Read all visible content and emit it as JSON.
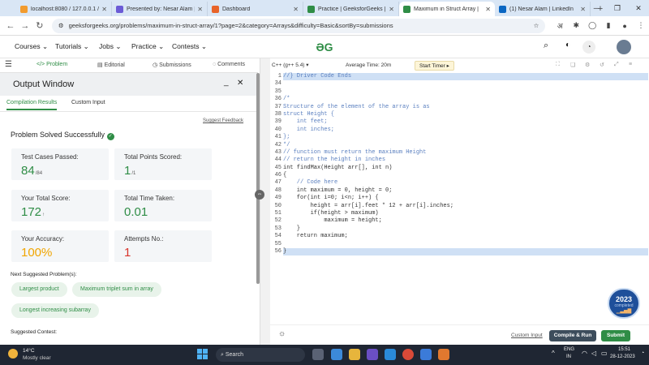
{
  "browser": {
    "tabs": [
      {
        "title": "localhost:8080 / 127.0.0.1 / ",
        "color": "#f29b2e",
        "active": false
      },
      {
        "title": "Presented by: Nesar Alam | ",
        "color": "#6b5bd6",
        "active": false
      },
      {
        "title": "Dashboard",
        "color": "#e8642a",
        "active": false
      },
      {
        "title": "Practice | GeeksforGeeks | ",
        "color": "#2f8d46",
        "active": false
      },
      {
        "title": "Maximum in Struct Array | ",
        "color": "#2f8d46",
        "active": true
      },
      {
        "title": "(1) Nesar Alam | LinkedIn",
        "color": "#0a66c2",
        "active": false
      }
    ],
    "url": "geeksforgeeks.org/problems/maximum-in-struct-array/1?page=2&category=Arrays&difficulty=Basic&sortBy=submissions",
    "lang_icon": "अ"
  },
  "site": {
    "menu": [
      "Courses",
      "Tutorials",
      "Jobs",
      "Practice",
      "Contests"
    ]
  },
  "problem_tabs": [
    "Problem",
    "Editorial",
    "Submissions",
    "Comments"
  ],
  "output": {
    "title": "Output Window",
    "tabs": [
      "Compilation Results",
      "Custom Input"
    ],
    "suggest_feedback": "Suggest Feedback",
    "status": "Problem Solved Successfully",
    "cards": [
      {
        "label": "Test Cases Passed:",
        "value": "84",
        "sub": "/84",
        "color": "#2f8d46"
      },
      {
        "label": "Total Points Scored:",
        "value": "1",
        "sub": "/1",
        "color": "#2f8d46"
      },
      {
        "label": "Your Total Score:",
        "value": "172",
        "sub": "↑",
        "color": "#2f8d46"
      },
      {
        "label": "Total Time Taken:",
        "value": "0.01",
        "sub": "",
        "color": "#2f8d46"
      },
      {
        "label": "Your Accuracy:",
        "value": "100%",
        "sub": "",
        "color": "#f0a500"
      },
      {
        "label": "Attempts No.:",
        "value": "1",
        "sub": "",
        "color": "#d9342b"
      }
    ],
    "next_label": "Next Suggested Problem(s):",
    "suggestions": [
      "Largest product",
      "Maximum triplet sum in array",
      "Longest increasing subarray"
    ],
    "contest_label": "Suggested Contest:"
  },
  "editor": {
    "language": "C++ (g++ 5.4)",
    "avg_time": "Average Time: 20m",
    "start_timer": "Start Timer",
    "lines": [
      {
        "n": "1",
        "t": "//} Driver Code Ends",
        "c": "cmt",
        "hl": true
      },
      {
        "n": "34",
        "t": "",
        "c": "",
        "hl": false
      },
      {
        "n": "35",
        "t": "",
        "c": "",
        "hl": false
      },
      {
        "n": "36",
        "t": "/*",
        "c": "cmt",
        "hl": false
      },
      {
        "n": "37",
        "t": "Structure of the element of the array is as",
        "c": "cmt",
        "hl": false
      },
      {
        "n": "38",
        "t": "struct Height {",
        "c": "cmt",
        "hl": false
      },
      {
        "n": "39",
        "t": "    int feet;",
        "c": "cmt",
        "hl": false
      },
      {
        "n": "40",
        "t": "    int inches;",
        "c": "cmt",
        "hl": false
      },
      {
        "n": "41",
        "t": "};",
        "c": "cmt",
        "hl": false
      },
      {
        "n": "42",
        "t": "*/",
        "c": "cmt",
        "hl": false
      },
      {
        "n": "43",
        "t": "// function must return the maximum Height",
        "c": "cmt",
        "hl": false
      },
      {
        "n": "44",
        "t": "// return the height in inches",
        "c": "cmt",
        "hl": false
      },
      {
        "n": "45",
        "t": "int findMax(Height arr[], int n)",
        "c": "kw",
        "hl": false
      },
      {
        "n": "46",
        "t": "{",
        "c": "kw",
        "hl": false
      },
      {
        "n": "47",
        "t": "    // Code here",
        "c": "cmt",
        "hl": false
      },
      {
        "n": "48",
        "t": "    int maximum = 0, height = 0;",
        "c": "kw",
        "hl": false
      },
      {
        "n": "49",
        "t": "    for(int i=0; i<n; i++) {",
        "c": "kw",
        "hl": false
      },
      {
        "n": "50",
        "t": "        height = arr[i].feet * 12 + arr[i].inches;",
        "c": "kw",
        "hl": false
      },
      {
        "n": "51",
        "t": "        if(height > maximum)",
        "c": "kw",
        "hl": false
      },
      {
        "n": "52",
        "t": "            maximum = height;",
        "c": "kw",
        "hl": false
      },
      {
        "n": "53",
        "t": "    }",
        "c": "kw",
        "hl": false
      },
      {
        "n": "54",
        "t": "    return maximum;",
        "c": "kw",
        "hl": false
      },
      {
        "n": "55",
        "t": "",
        "c": "",
        "hl": false
      },
      {
        "n": "56",
        "t": "}",
        "c": "kw",
        "hl": true
      }
    ],
    "custom_input": "Custom Input",
    "compile_run": "Compile & Run",
    "submit": "Submit"
  },
  "badge": {
    "year": "2023",
    "text": "completed"
  },
  "taskbar": {
    "weather_temp": "14°C",
    "weather_desc": "Mostly clear",
    "search": "Search",
    "lang": "ENG",
    "region": "IN",
    "time": "15:51",
    "date": "28-12-2023"
  }
}
